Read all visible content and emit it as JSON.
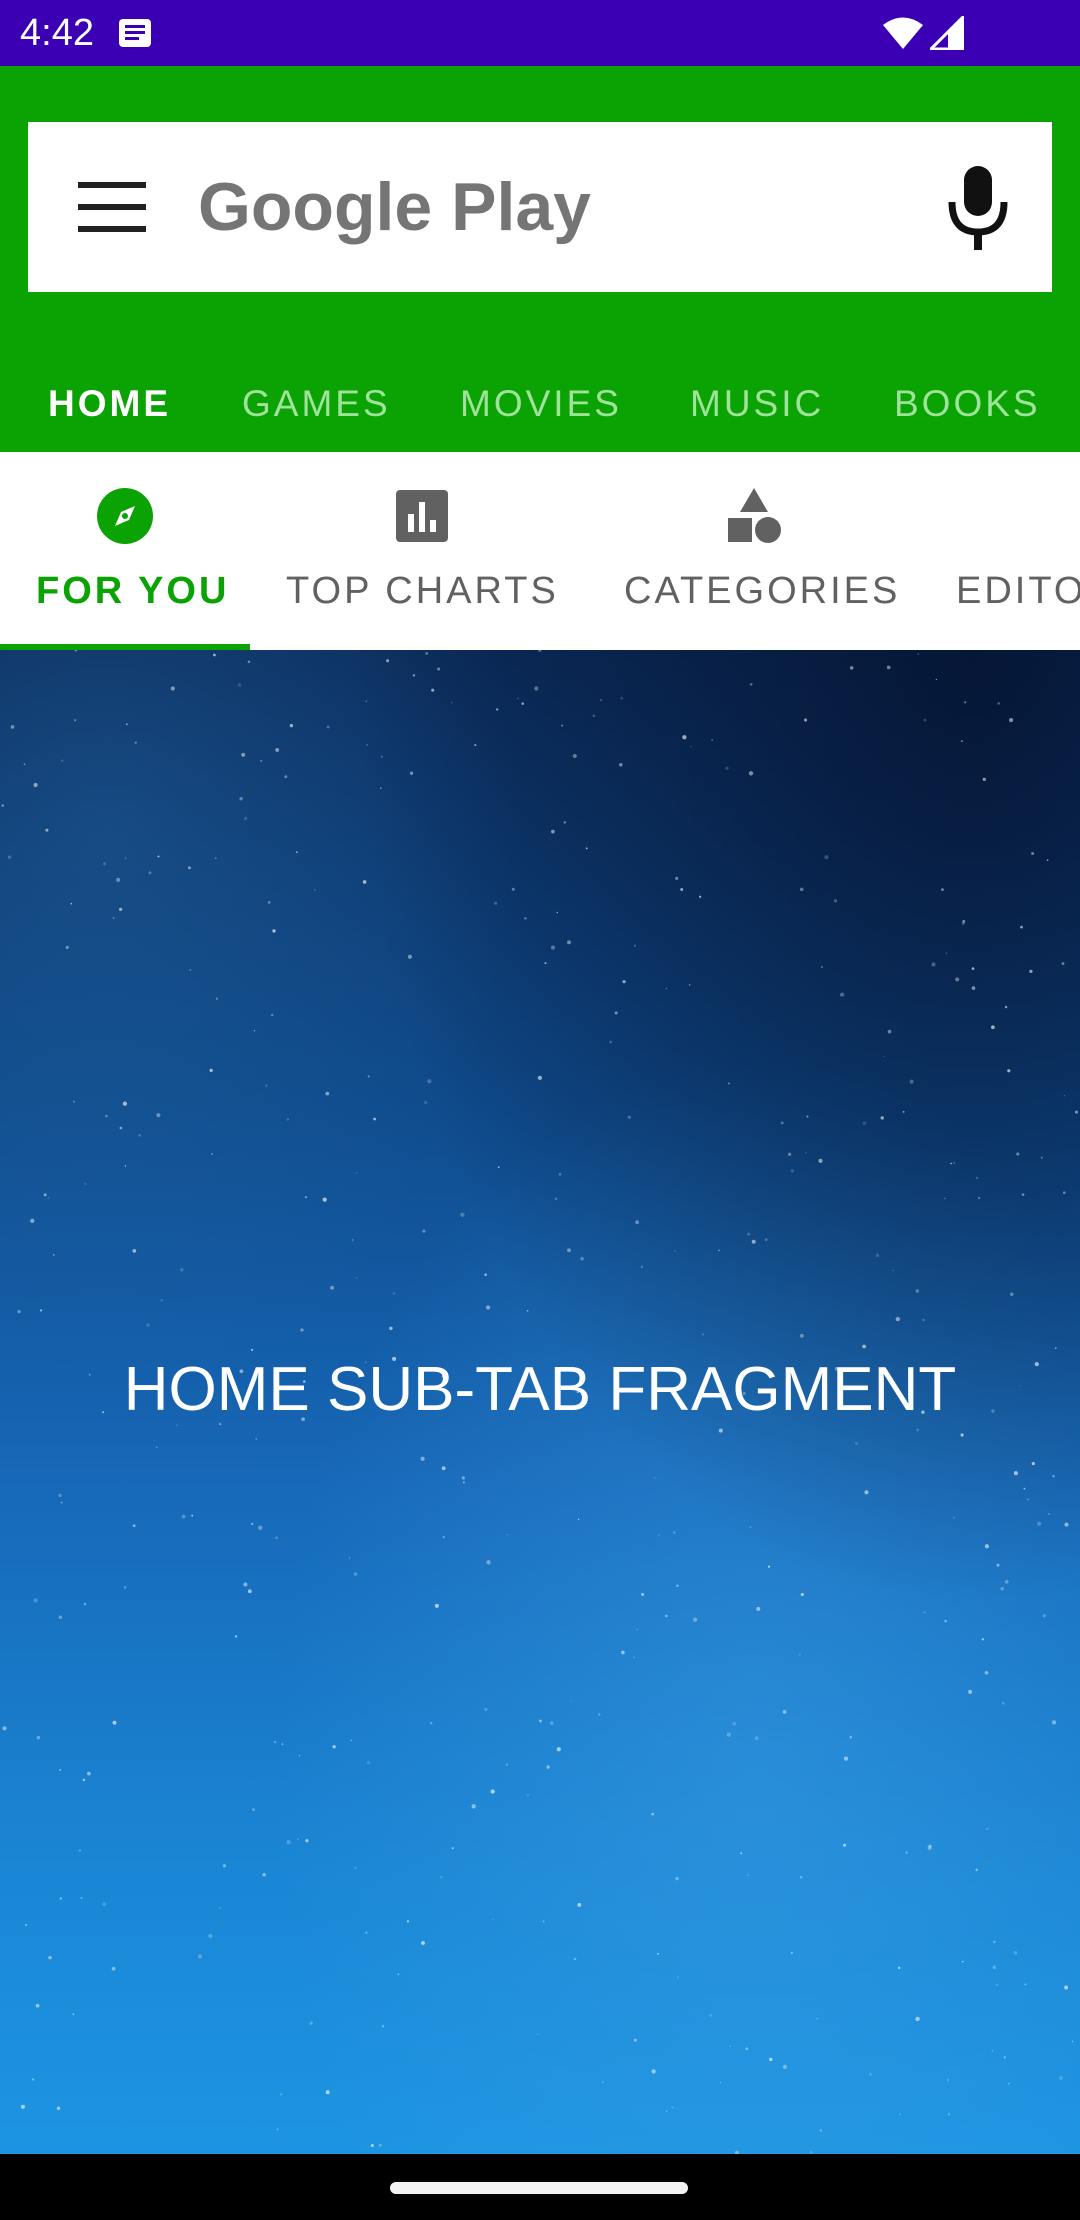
{
  "status_bar": {
    "time": "4:42",
    "background": "#3b00b3",
    "icons": [
      "notification-icon",
      "wifi-icon",
      "signal-icon"
    ]
  },
  "app_bar": {
    "background": "#0aa303",
    "search": {
      "title": "Google Play",
      "menu_icon": "menu-icon",
      "mic_icon": "mic-icon"
    },
    "tabs": [
      {
        "label": "HOME",
        "active": true
      },
      {
        "label": "GAMES",
        "active": false
      },
      {
        "label": "MOVIES",
        "active": false
      },
      {
        "label": "MUSIC",
        "active": false
      },
      {
        "label": "BOOKS",
        "active": false
      }
    ]
  },
  "sub_tabs": [
    {
      "label": "FOR YOU",
      "icon": "compass-icon",
      "active": true
    },
    {
      "label": "TOP CHARTS",
      "icon": "bar-chart-icon",
      "active": false
    },
    {
      "label": "CATEGORIES",
      "icon": "shapes-icon",
      "active": false
    },
    {
      "label": "EDITO",
      "icon": "",
      "active": false
    }
  ],
  "content": {
    "label": "HOME SUB-TAB FRAGMENT"
  },
  "colors": {
    "accent": "#0aa303",
    "inactive_top_tab": "#9fe39a",
    "inactive_sub_tab": "#616161"
  }
}
